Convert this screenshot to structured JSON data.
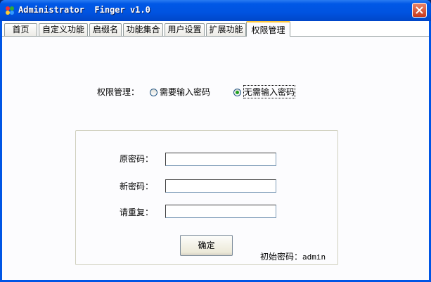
{
  "window": {
    "title": "Administrator  Finger v1.0",
    "app_icon": "app-icon",
    "close_icon": "close-icon"
  },
  "tabs": [
    {
      "label": "首页",
      "active": false
    },
    {
      "label": "自定义功能",
      "active": false
    },
    {
      "label": "启缀名",
      "active": false
    },
    {
      "label": "功能集合",
      "active": false
    },
    {
      "label": "用户设置",
      "active": false
    },
    {
      "label": "扩展功能",
      "active": false
    },
    {
      "label": "权限管理",
      "active": true
    }
  ],
  "permission": {
    "label": "权限管理：",
    "options": [
      {
        "label": "需要输入密码",
        "selected": false
      },
      {
        "label": "无需输入密码",
        "selected": true
      }
    ]
  },
  "password_form": {
    "old_label": "原密码：",
    "old_value": "",
    "new_label": "新密码：",
    "new_value": "",
    "repeat_label": "请重复：",
    "repeat_value": "",
    "confirm_label": "确定",
    "initial_note_label": "初始密码：",
    "initial_note_value": "admin"
  }
}
